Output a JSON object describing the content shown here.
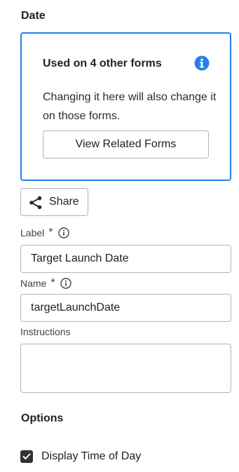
{
  "section_date": {
    "title": "Date"
  },
  "info_card": {
    "heading": "Used on 4 other forms",
    "description": "Changing it here will also change it on those forms.",
    "button_label": "View Related Forms",
    "accent_color": "#2680eb",
    "icon": "info-icon"
  },
  "share": {
    "label": "Share",
    "icon": "share-icon"
  },
  "fields": {
    "label": {
      "label": "Label",
      "required": "*",
      "value": "Target Launch Date"
    },
    "name": {
      "label": "Name",
      "required": "*",
      "value": "targetLaunchDate"
    },
    "instructions": {
      "label": "Instructions",
      "value": ""
    }
  },
  "section_options": {
    "title": "Options"
  },
  "options": {
    "display_time_of_day": {
      "label": "Display Time of Day",
      "checked": true
    }
  }
}
